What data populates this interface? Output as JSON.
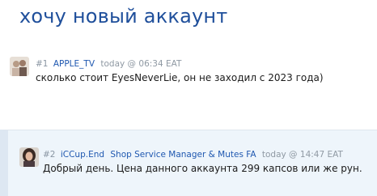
{
  "thread": {
    "title": "хочу новый аккаунт"
  },
  "posts": [
    {
      "number": "#1",
      "author": "APPLE_TV",
      "user_title": "",
      "time": "today @ 06:34 EAT",
      "message": "сколько стоит EyesNeverLie, он не заходил с 2023 года)"
    },
    {
      "number": "#2",
      "author": "iCCup.End",
      "user_title": "Shop Service Manager & Mutes FA",
      "time": "today @ 14:47 EAT",
      "message": "Добрый день. Цена данного аккаунта 299 капсов или же рун."
    }
  ],
  "colors": {
    "title": "#1f4f9b",
    "link": "#1f58b0",
    "meta": "#8f99a3",
    "highlight_bg": "#eef5fb"
  }
}
